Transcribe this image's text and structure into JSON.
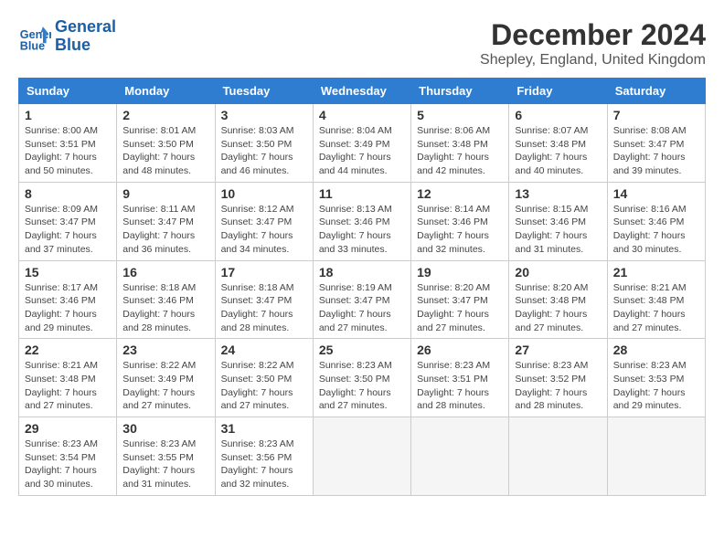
{
  "logo": {
    "line1": "General",
    "line2": "Blue"
  },
  "title": "December 2024",
  "subtitle": "Shepley, England, United Kingdom",
  "days_of_week": [
    "Sunday",
    "Monday",
    "Tuesday",
    "Wednesday",
    "Thursday",
    "Friday",
    "Saturday"
  ],
  "weeks": [
    [
      {
        "day": "1",
        "info": "Sunrise: 8:00 AM\nSunset: 3:51 PM\nDaylight: 7 hours and 50 minutes."
      },
      {
        "day": "2",
        "info": "Sunrise: 8:01 AM\nSunset: 3:50 PM\nDaylight: 7 hours and 48 minutes."
      },
      {
        "day": "3",
        "info": "Sunrise: 8:03 AM\nSunset: 3:50 PM\nDaylight: 7 hours and 46 minutes."
      },
      {
        "day": "4",
        "info": "Sunrise: 8:04 AM\nSunset: 3:49 PM\nDaylight: 7 hours and 44 minutes."
      },
      {
        "day": "5",
        "info": "Sunrise: 8:06 AM\nSunset: 3:48 PM\nDaylight: 7 hours and 42 minutes."
      },
      {
        "day": "6",
        "info": "Sunrise: 8:07 AM\nSunset: 3:48 PM\nDaylight: 7 hours and 40 minutes."
      },
      {
        "day": "7",
        "info": "Sunrise: 8:08 AM\nSunset: 3:47 PM\nDaylight: 7 hours and 39 minutes."
      }
    ],
    [
      {
        "day": "8",
        "info": "Sunrise: 8:09 AM\nSunset: 3:47 PM\nDaylight: 7 hours and 37 minutes."
      },
      {
        "day": "9",
        "info": "Sunrise: 8:11 AM\nSunset: 3:47 PM\nDaylight: 7 hours and 36 minutes."
      },
      {
        "day": "10",
        "info": "Sunrise: 8:12 AM\nSunset: 3:47 PM\nDaylight: 7 hours and 34 minutes."
      },
      {
        "day": "11",
        "info": "Sunrise: 8:13 AM\nSunset: 3:46 PM\nDaylight: 7 hours and 33 minutes."
      },
      {
        "day": "12",
        "info": "Sunrise: 8:14 AM\nSunset: 3:46 PM\nDaylight: 7 hours and 32 minutes."
      },
      {
        "day": "13",
        "info": "Sunrise: 8:15 AM\nSunset: 3:46 PM\nDaylight: 7 hours and 31 minutes."
      },
      {
        "day": "14",
        "info": "Sunrise: 8:16 AM\nSunset: 3:46 PM\nDaylight: 7 hours and 30 minutes."
      }
    ],
    [
      {
        "day": "15",
        "info": "Sunrise: 8:17 AM\nSunset: 3:46 PM\nDaylight: 7 hours and 29 minutes."
      },
      {
        "day": "16",
        "info": "Sunrise: 8:18 AM\nSunset: 3:46 PM\nDaylight: 7 hours and 28 minutes."
      },
      {
        "day": "17",
        "info": "Sunrise: 8:18 AM\nSunset: 3:47 PM\nDaylight: 7 hours and 28 minutes."
      },
      {
        "day": "18",
        "info": "Sunrise: 8:19 AM\nSunset: 3:47 PM\nDaylight: 7 hours and 27 minutes."
      },
      {
        "day": "19",
        "info": "Sunrise: 8:20 AM\nSunset: 3:47 PM\nDaylight: 7 hours and 27 minutes."
      },
      {
        "day": "20",
        "info": "Sunrise: 8:20 AM\nSunset: 3:48 PM\nDaylight: 7 hours and 27 minutes."
      },
      {
        "day": "21",
        "info": "Sunrise: 8:21 AM\nSunset: 3:48 PM\nDaylight: 7 hours and 27 minutes."
      }
    ],
    [
      {
        "day": "22",
        "info": "Sunrise: 8:21 AM\nSunset: 3:48 PM\nDaylight: 7 hours and 27 minutes."
      },
      {
        "day": "23",
        "info": "Sunrise: 8:22 AM\nSunset: 3:49 PM\nDaylight: 7 hours and 27 minutes."
      },
      {
        "day": "24",
        "info": "Sunrise: 8:22 AM\nSunset: 3:50 PM\nDaylight: 7 hours and 27 minutes."
      },
      {
        "day": "25",
        "info": "Sunrise: 8:23 AM\nSunset: 3:50 PM\nDaylight: 7 hours and 27 minutes."
      },
      {
        "day": "26",
        "info": "Sunrise: 8:23 AM\nSunset: 3:51 PM\nDaylight: 7 hours and 28 minutes."
      },
      {
        "day": "27",
        "info": "Sunrise: 8:23 AM\nSunset: 3:52 PM\nDaylight: 7 hours and 28 minutes."
      },
      {
        "day": "28",
        "info": "Sunrise: 8:23 AM\nSunset: 3:53 PM\nDaylight: 7 hours and 29 minutes."
      }
    ],
    [
      {
        "day": "29",
        "info": "Sunrise: 8:23 AM\nSunset: 3:54 PM\nDaylight: 7 hours and 30 minutes."
      },
      {
        "day": "30",
        "info": "Sunrise: 8:23 AM\nSunset: 3:55 PM\nDaylight: 7 hours and 31 minutes."
      },
      {
        "day": "31",
        "info": "Sunrise: 8:23 AM\nSunset: 3:56 PM\nDaylight: 7 hours and 32 minutes."
      },
      {
        "day": "",
        "info": ""
      },
      {
        "day": "",
        "info": ""
      },
      {
        "day": "",
        "info": ""
      },
      {
        "day": "",
        "info": ""
      }
    ]
  ]
}
